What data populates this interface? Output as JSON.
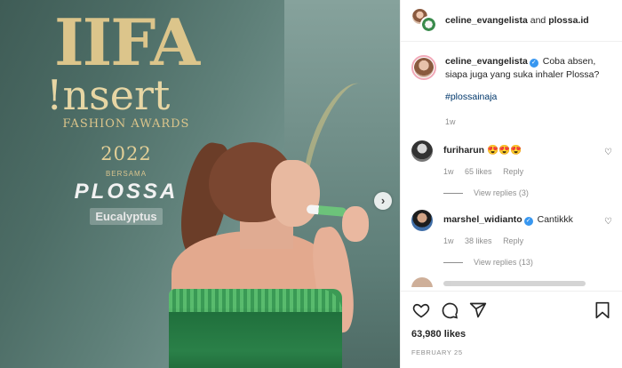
{
  "post": {
    "header": {
      "username": "celine_evangelista",
      "joiner": "and",
      "collaborator": "plossa.id"
    },
    "caption": {
      "username": "celine_evangelista",
      "text": "Coba absen, siapa juga yang suka inhaler Plossa?",
      "hashtag": "#plossainaja",
      "time": "1w"
    },
    "comments": [
      {
        "username": "furiharun",
        "text": "😍😍😍",
        "time": "1w",
        "likes": "65 likes",
        "reply": "Reply",
        "view_replies": "View replies (3)"
      },
      {
        "username": "marshel_widianto",
        "verified": true,
        "text": "Cantikkk",
        "time": "1w",
        "likes": "38 likes",
        "reply": "Reply",
        "view_replies": "View replies (13)"
      }
    ],
    "likes_count": "63,980 likes",
    "date": "FEBRUARY 25"
  },
  "photo": {
    "logo_iifa": "IIFA",
    "logo_insert": "!nsert",
    "logo_fashion": "FASHION AWARDS",
    "logo_year": "2022",
    "logo_bersama": "BERSAMA",
    "logo_brand": "PLOSSA",
    "logo_sub": "Eucalyptus"
  },
  "icons": {
    "next": "chevron-right-icon",
    "like": "heart-icon",
    "comment": "comment-icon",
    "share": "send-icon",
    "save": "bookmark-icon"
  },
  "colors": {
    "verified": "#3897f0",
    "hashtag": "#00376b",
    "muted": "#8e8e8e"
  }
}
